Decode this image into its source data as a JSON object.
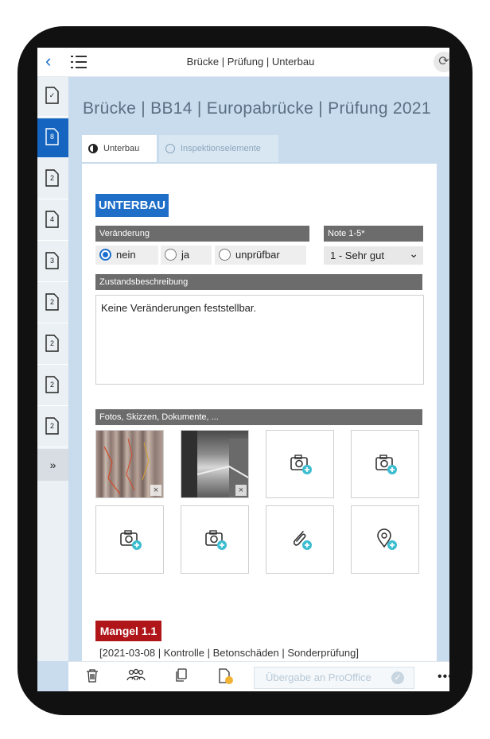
{
  "topbar": {
    "back_icon": "chevron-left-icon",
    "menu_icon": "list-icon",
    "title": "Brücke | Prüfung | Unterbau",
    "sync_icon": "sync-icon"
  },
  "sidebar": {
    "items": [
      {
        "label": "✓",
        "icon": "document-check-icon",
        "active": false
      },
      {
        "label": "8",
        "icon": "document-icon",
        "active": true
      },
      {
        "label": "2",
        "icon": "document-icon",
        "active": false
      },
      {
        "label": "4",
        "icon": "document-icon",
        "active": false
      },
      {
        "label": "3",
        "icon": "document-icon",
        "active": false
      },
      {
        "label": "2",
        "icon": "document-icon",
        "active": false
      },
      {
        "label": "2",
        "icon": "document-icon",
        "active": false
      },
      {
        "label": "2",
        "icon": "document-icon",
        "active": false
      },
      {
        "label": "2",
        "icon": "document-icon",
        "active": false
      }
    ],
    "more_label": "»"
  },
  "page": {
    "title": "Brücke | BB14 | Europabrücke | Prüfung 2021"
  },
  "tabs": [
    {
      "label": "Unterbau",
      "active": true
    },
    {
      "label": "Inspektionselemente",
      "active": false
    }
  ],
  "section": {
    "title": "UNTERBAU",
    "change_label": "Veränderung",
    "grade_label": "Note 1-5*",
    "options": [
      {
        "label": "nein",
        "checked": true
      },
      {
        "label": "ja",
        "checked": false
      },
      {
        "label": "unprüfbar",
        "checked": false
      }
    ],
    "grade_value": "1 - Sehr gut",
    "description_label": "Zustandsbeschreibung",
    "description_value": "Keine Veränderungen feststellbar.",
    "media_label": "Fotos, Skizzen, Dokumente, ...",
    "media_tiles": [
      "photo",
      "photo",
      "add-photo-icon",
      "add-photo-icon",
      "add-photo-icon",
      "add-photo-icon",
      "add-attachment-icon",
      "add-location-icon"
    ],
    "remove_symbol": "×"
  },
  "defect": {
    "title": "Mangel 1.1",
    "subtitle": "[2021-03-08 | Kontrolle | Betonschäden | Sonderprüfung]"
  },
  "bottombar": {
    "icons": [
      "trash-icon",
      "people-icon",
      "copy-icon",
      "pdf-icon"
    ],
    "handover_label": "Übergabe an ProOffice",
    "more_label": "•••"
  },
  "colors": {
    "accent": "#1f6fc8",
    "defect": "#b0151a",
    "sidebar_active": "#1565c0",
    "add_badge": "#3cbdd0"
  }
}
